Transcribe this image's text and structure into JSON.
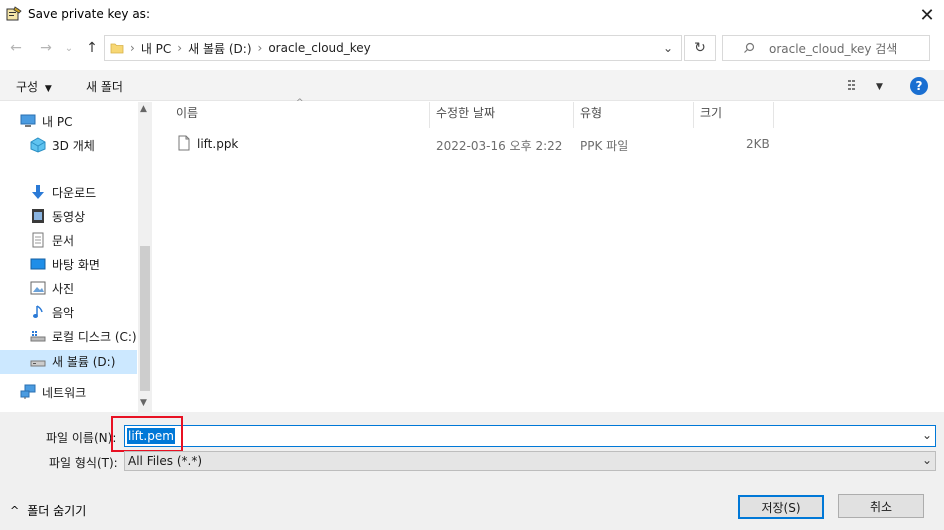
{
  "window": {
    "title": "Save private key as:"
  },
  "nav": {
    "breadcrumb": [
      "내 PC",
      "새 볼륨 (D:)",
      "oracle_cloud_key"
    ],
    "search_placeholder": "oracle_cloud_key 검색"
  },
  "toolbar": {
    "organize": "구성",
    "new_folder": "새 폴더"
  },
  "sidebar": {
    "items": [
      {
        "label": "내 PC",
        "icon": "pc-icon"
      },
      {
        "label": "3D 개체",
        "icon": "3d-objects-icon"
      },
      {
        "label": "다운로드",
        "icon": "download-icon"
      },
      {
        "label": "동영상",
        "icon": "video-icon"
      },
      {
        "label": "문서",
        "icon": "document-icon"
      },
      {
        "label": "바탕 화면",
        "icon": "desktop-icon"
      },
      {
        "label": "사진",
        "icon": "picture-icon"
      },
      {
        "label": "음악",
        "icon": "music-icon"
      },
      {
        "label": "로컬 디스크 (C:)",
        "icon": "local-disk-icon"
      },
      {
        "label": "새 볼륨 (D:)",
        "icon": "drive-icon"
      },
      {
        "label": "네트워크",
        "icon": "network-icon"
      }
    ]
  },
  "file_list": {
    "columns": [
      "이름",
      "수정한 날짜",
      "유형",
      "크기"
    ],
    "rows": [
      {
        "name": "lift.ppk",
        "modified": "2022-03-16 오후 2:22",
        "type": "PPK 파일",
        "size": "2KB"
      }
    ]
  },
  "form": {
    "filename_label": "파일 이름(N):",
    "filename_value": "lift.pem",
    "filetype_label": "파일 형식(T):",
    "filetype_value": "All Files (*.*)"
  },
  "footer": {
    "hide_folders": "폴더 숨기기",
    "save": "저장(S)",
    "cancel": "취소"
  },
  "colors": {
    "accent": "#0078d7",
    "highlight": "#e81123",
    "selection": "#cce8ff"
  }
}
